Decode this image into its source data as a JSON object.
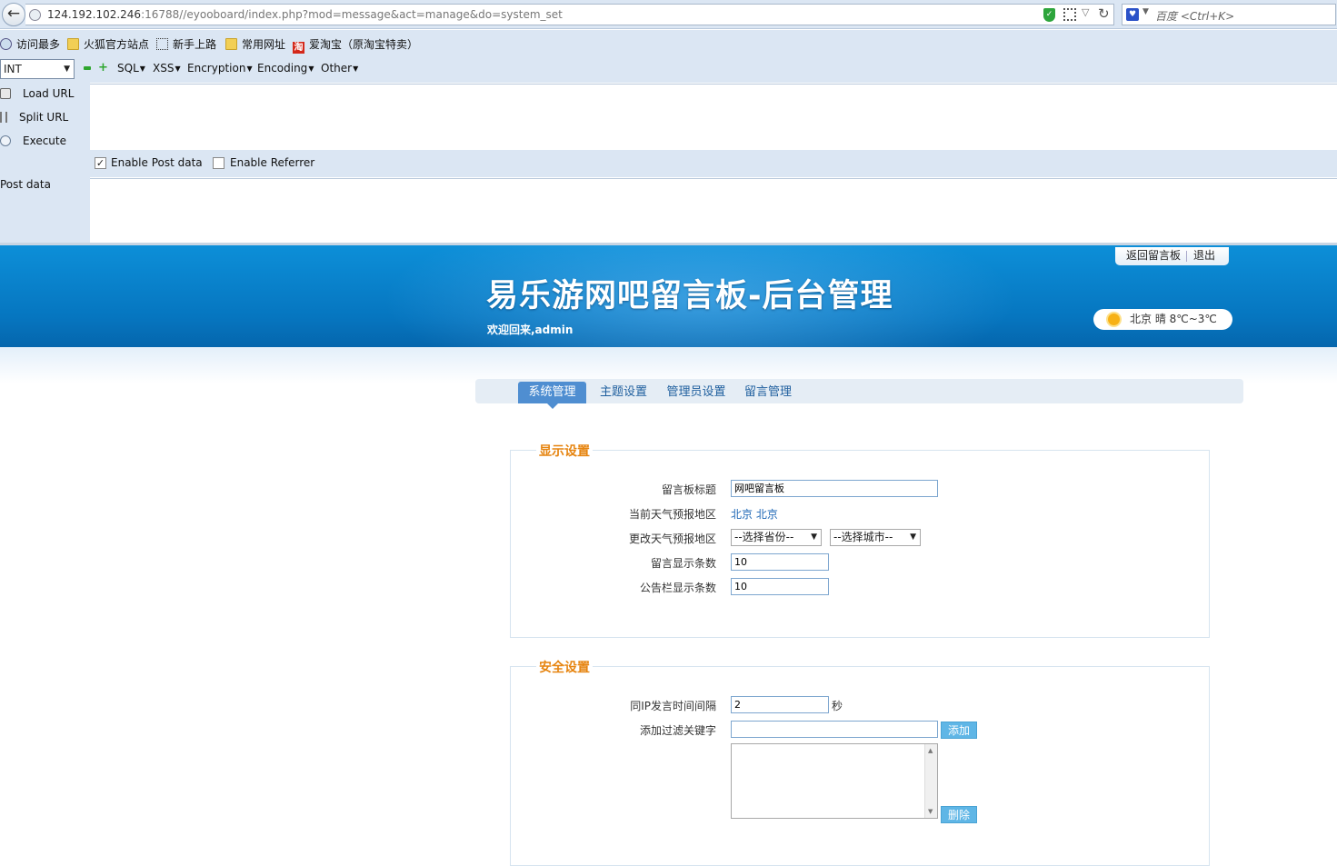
{
  "browser": {
    "url_host": "124.192.102.246",
    "url_rest": ":16788//eyooboard/index.php?mod=message&act=manage&do=system_set",
    "search_placeholder": "百度 <Ctrl+K>",
    "bookmarks": [
      "访问最多",
      "火狐官方站点",
      "新手上路",
      "常用网址",
      "爱淘宝（原淘宝特卖）"
    ],
    "taobao_glyph": "淘"
  },
  "hackbar": {
    "type_select": "INT",
    "menus": [
      "SQL",
      "XSS",
      "Encryption",
      "Encoding",
      "Other"
    ],
    "load_url": "Load URL",
    "split_url": "Split URL",
    "execute": "Execute",
    "enable_post": "Enable Post data",
    "enable_referrer": "Enable Referrer",
    "post_checked": true,
    "referrer_checked": false,
    "post_data_label": "Post data"
  },
  "site": {
    "title": "易乐游网吧留言板-后台管理",
    "welcome": "欢迎回来,admin",
    "back_link": "返回留言板",
    "logout_link": "退出",
    "weather": "北京  晴  8℃~3℃",
    "tabs": [
      "系统管理",
      "主题设置",
      "管理员设置",
      "留言管理"
    ]
  },
  "display_settings": {
    "legend": "显示设置",
    "board_title_label": "留言板标题",
    "board_title_value": "网吧留言板",
    "current_region_label": "当前天气预报地区",
    "current_region_value": "北京 北京",
    "change_region_label": "更改天气预报地区",
    "province_select": "--选择省份--",
    "city_select": "--选择城市--",
    "msg_count_label": "留言显示条数",
    "msg_count_value": "10",
    "notice_count_label": "公告栏显示条数",
    "notice_count_value": "10"
  },
  "security_settings": {
    "legend": "安全设置",
    "ip_interval_label": "同IP发言时间间隔",
    "ip_interval_value": "2",
    "ip_interval_unit": "秒",
    "filter_label": "添加过滤关键字",
    "filter_value": "",
    "add_button": "添加",
    "delete_button": "删除"
  }
}
